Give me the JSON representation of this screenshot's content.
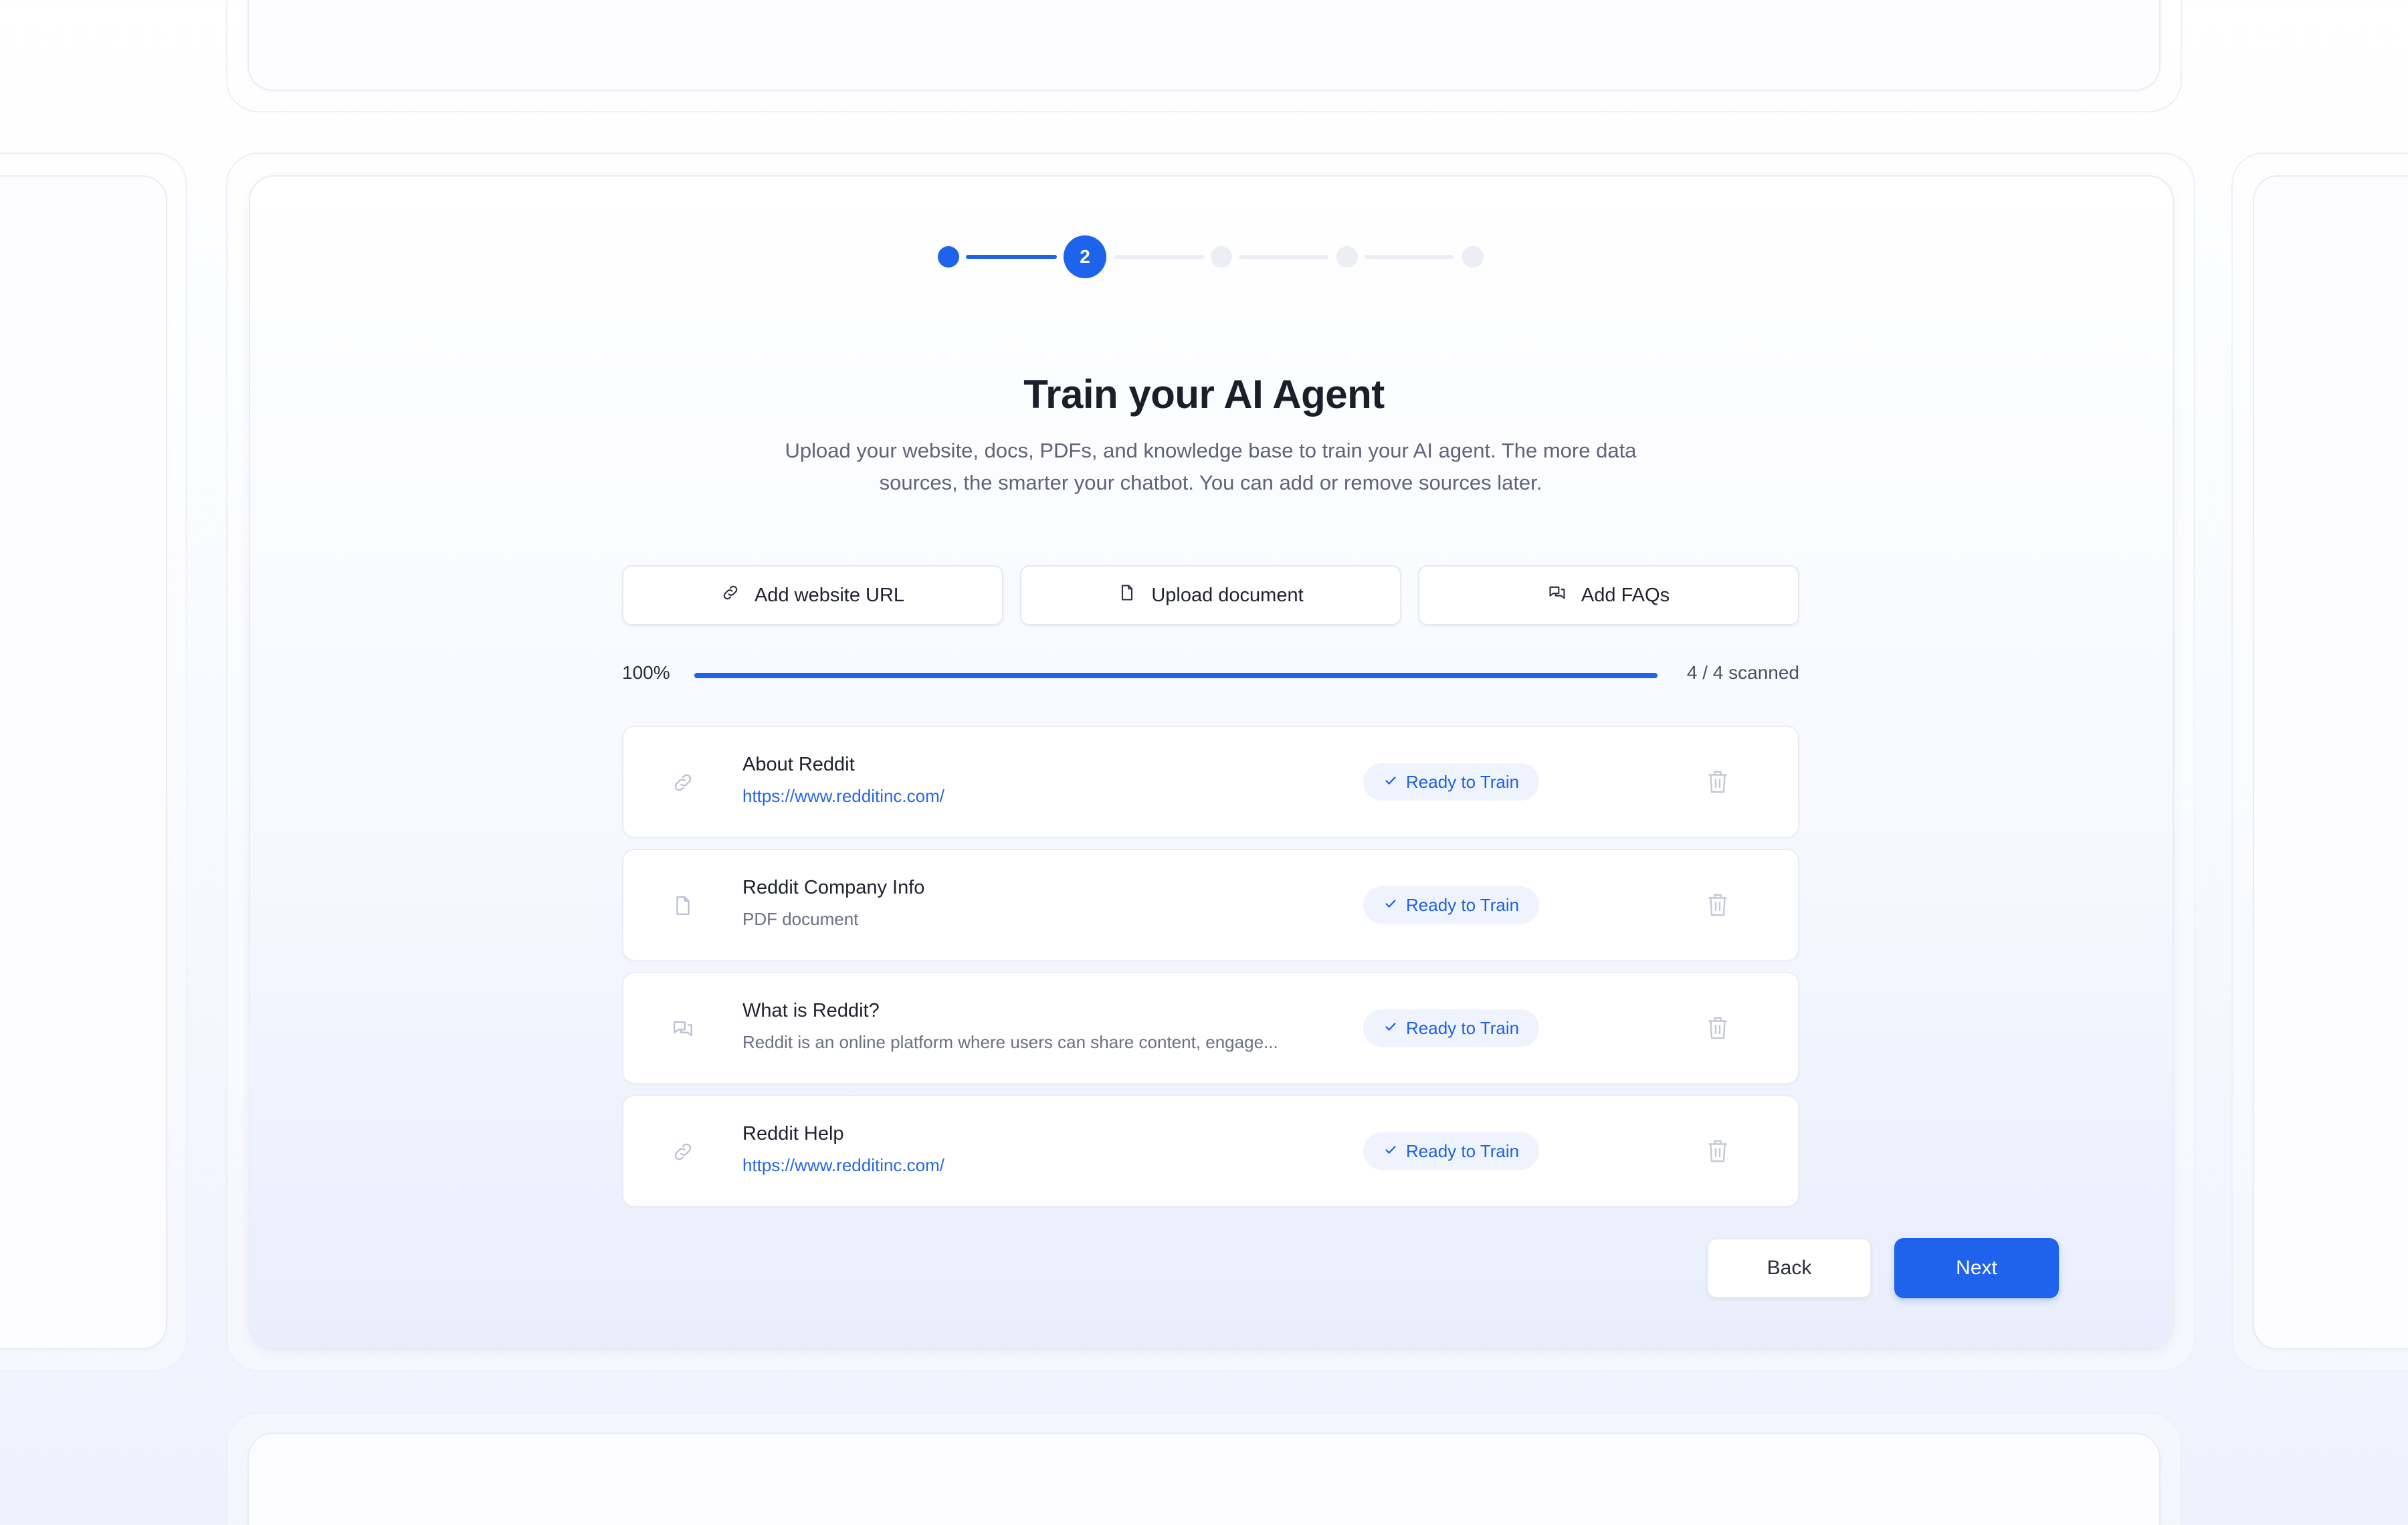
{
  "stepper": {
    "current_step": "2",
    "total_steps": 5
  },
  "header": {
    "title": "Train your AI Agent",
    "subtitle_line1": "Upload your website, docs, PDFs, and knowledge base to train your AI agent. The more data",
    "subtitle_line2": "sources, the smarter your chatbot. You can add or remove sources later."
  },
  "actions": {
    "add_url": "Add website URL",
    "upload_doc": "Upload document",
    "add_faqs": "Add FAQs"
  },
  "progress": {
    "percent_label": "100%",
    "fraction": 1.0,
    "scanned_label": "4 / 4 scanned"
  },
  "sources": [
    {
      "title": "About Reddit",
      "subtitle": "https://www.redditinc.com/",
      "type_icon": "link-icon",
      "status": "Ready to Train"
    },
    {
      "title": "Reddit Company Info",
      "subtitle": "PDF document",
      "type_icon": "document-icon",
      "status": "Ready to Train"
    },
    {
      "title": "What is Reddit?",
      "subtitle": "Reddit is an online platform where users can share content, engage...",
      "type_icon": "chat-icon",
      "status": "Ready to Train"
    },
    {
      "title": "Reddit Help",
      "subtitle": "https://www.redditinc.com/",
      "type_icon": "link-icon",
      "status": "Ready to Train"
    }
  ],
  "footer": {
    "back_label": "Back",
    "next_label": "Next"
  },
  "colors": {
    "accent": "#1e63eb",
    "badge_bg": "#eff3fd",
    "muted_text": "#6a7084"
  }
}
